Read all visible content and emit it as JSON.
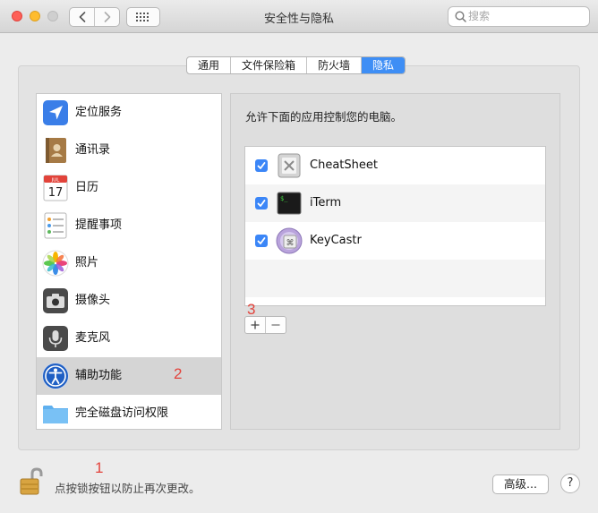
{
  "window": {
    "title": "安全性与隐私",
    "search_placeholder": "搜索"
  },
  "tabs": [
    {
      "label": "通用",
      "active": false
    },
    {
      "label": "文件保险箱",
      "active": false
    },
    {
      "label": "防火墙",
      "active": false
    },
    {
      "label": "隐私",
      "active": true
    }
  ],
  "sidebar": {
    "items": [
      {
        "label": "定位服务",
        "icon": "location-arrow-icon"
      },
      {
        "label": "通讯录",
        "icon": "contacts-book-icon"
      },
      {
        "label": "日历",
        "icon": "calendar-icon",
        "icon_month": "JUL",
        "icon_day": "17"
      },
      {
        "label": "提醒事项",
        "icon": "reminders-icon"
      },
      {
        "label": "照片",
        "icon": "photos-icon"
      },
      {
        "label": "摄像头",
        "icon": "camera-icon"
      },
      {
        "label": "麦克风",
        "icon": "microphone-icon"
      },
      {
        "label": "辅助功能",
        "icon": "accessibility-icon",
        "selected": true
      },
      {
        "label": "完全磁盘访问权限",
        "icon": "folder-icon"
      }
    ]
  },
  "main": {
    "description": "允许下面的应用控制您的电脑。",
    "apps": [
      {
        "name": "CheatSheet",
        "checked": true,
        "icon": "cheatsheet-app-icon"
      },
      {
        "name": "iTerm",
        "checked": true,
        "icon": "iterm-app-icon",
        "icon_prompt": "$_"
      },
      {
        "name": "KeyCastr",
        "checked": true,
        "icon": "keycastr-app-icon"
      }
    ],
    "add_label": "+",
    "remove_label": "−"
  },
  "annotations": {
    "one": "1",
    "two": "2",
    "three": "3",
    "color": "#e3433c"
  },
  "footer": {
    "lock_text": "点按锁按钮以防止再次更改。",
    "advanced_label": "高级...",
    "help_label": "?"
  },
  "colors": {
    "accent": "#3e8ef5",
    "checkbox": "#3b86f7"
  }
}
